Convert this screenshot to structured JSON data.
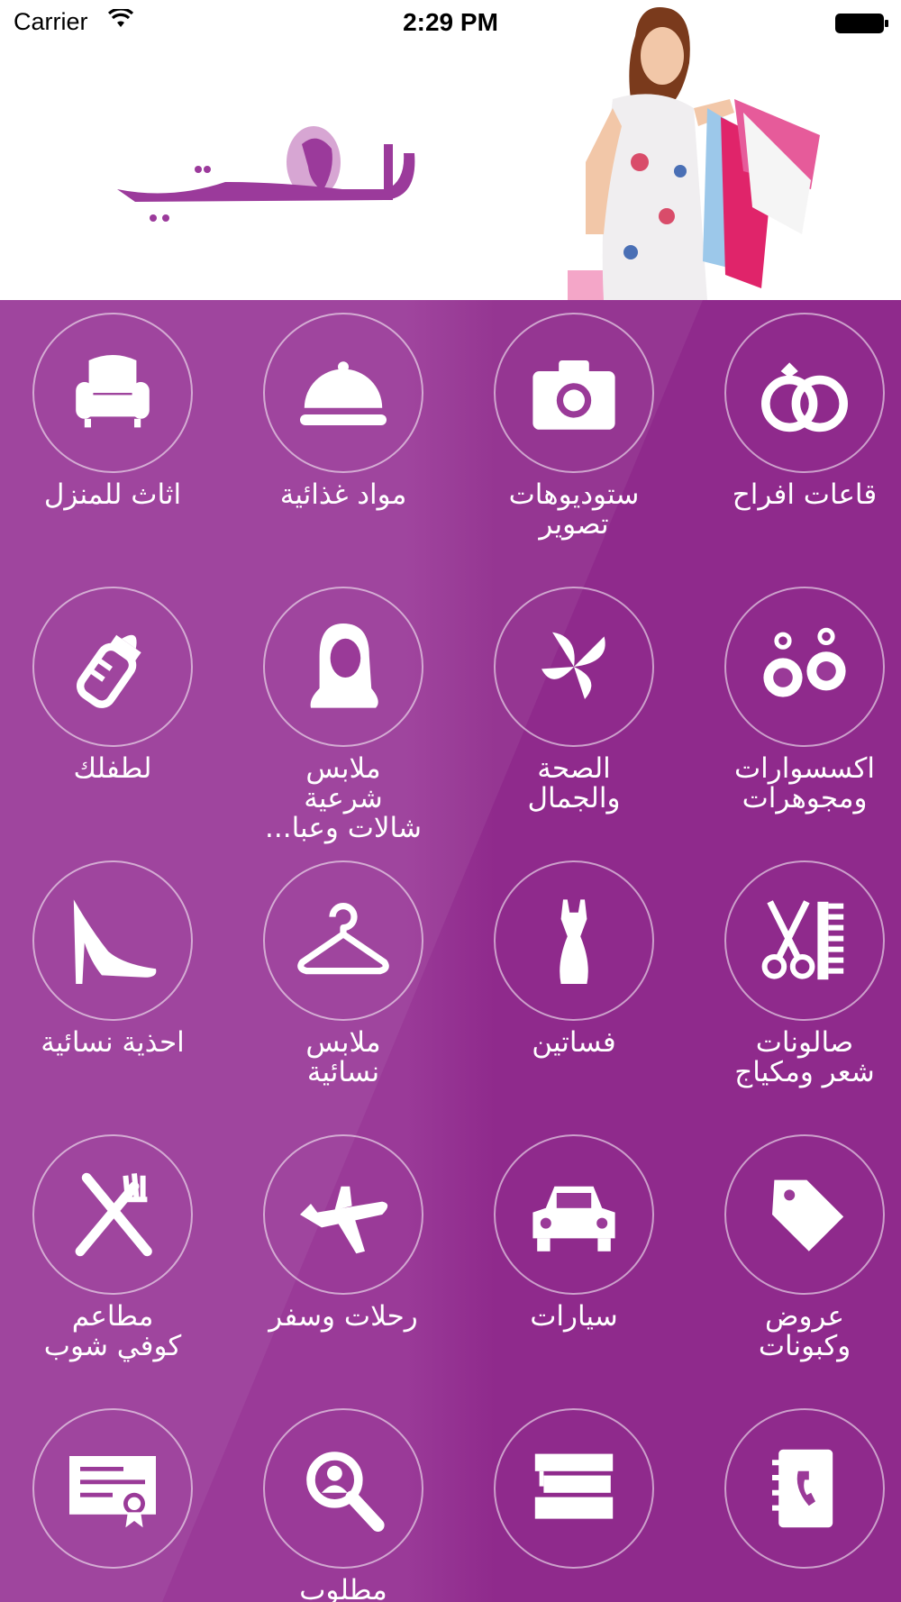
{
  "status_bar": {
    "carrier": "Carrier",
    "time": "2:29 PM"
  },
  "brand": {
    "logo_text": "لكِ سيدتي",
    "primary_color": "#8e2a8e",
    "logo_color": "#9b3a9b",
    "logo_accent": "#d7a6d3"
  },
  "categories": [
    {
      "label": "قاعات افراح",
      "icon": "rings-icon"
    },
    {
      "label": "ستوديوهات\nتصوير",
      "icon": "camera-icon"
    },
    {
      "label": "مواد غذائية",
      "icon": "food-cloche-icon"
    },
    {
      "label": "اثاث للمنزل",
      "icon": "armchair-icon"
    },
    {
      "label": "اكسسوارات\nومجوهرات",
      "icon": "earrings-icon"
    },
    {
      "label": "الصحة\nوالجمال",
      "icon": "butterfly-icon"
    },
    {
      "label": "ملابس\nشرعية\nشالات وعبا...",
      "icon": "hijab-woman-icon"
    },
    {
      "label": "لطفلك",
      "icon": "baby-bottle-icon"
    },
    {
      "label": "صالونات\nشعر ومكياج",
      "icon": "scissors-comb-icon"
    },
    {
      "label": "فساتين",
      "icon": "dress-icon"
    },
    {
      "label": "ملابس\nنسائية",
      "icon": "hanger-icon"
    },
    {
      "label": "احذية نسائية",
      "icon": "high-heel-icon"
    },
    {
      "label": "عروض\nوكبونات",
      "icon": "price-tag-icon"
    },
    {
      "label": "سيارات",
      "icon": "car-icon"
    },
    {
      "label": "رحلات وسفر",
      "icon": "airplane-icon"
    },
    {
      "label": "مطاعم\nكوفي شوب",
      "icon": "fork-knife-icon"
    },
    {
      "label": "",
      "icon": "phonebook-icon"
    },
    {
      "label": "",
      "icon": "books-icon"
    },
    {
      "label": "مطلوب",
      "icon": "person-search-icon"
    },
    {
      "label": "",
      "icon": "certificate-icon"
    }
  ]
}
